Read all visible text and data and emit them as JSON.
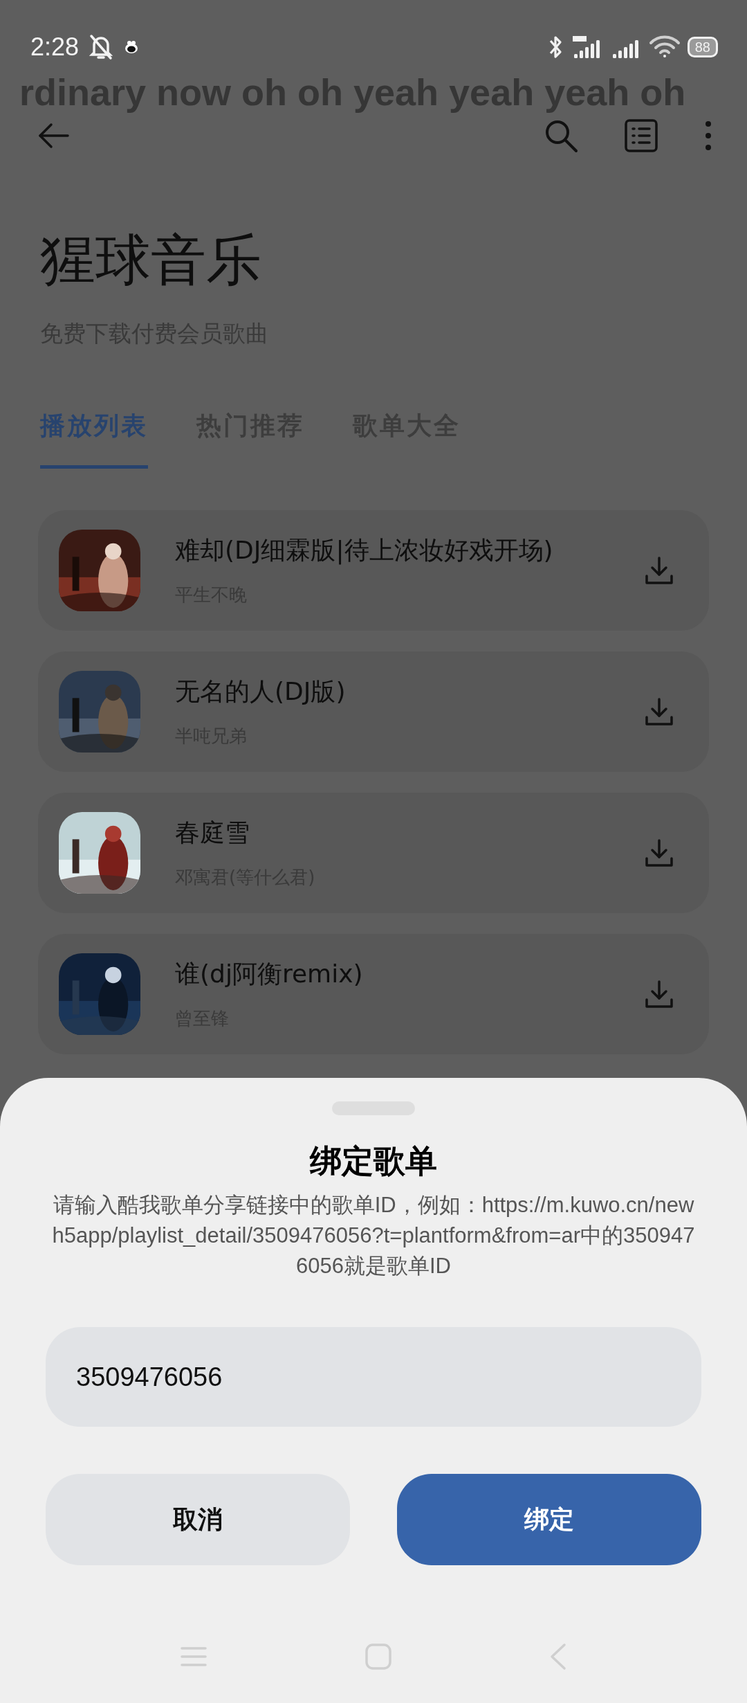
{
  "status_bar": {
    "time": "2:28",
    "battery": "88"
  },
  "lyrics_banner": {
    "text": "rdinary now oh oh yeah yeah yeah oh"
  },
  "header": {
    "title": "猩球音乐",
    "subtitle": "免费下载付费会员歌曲"
  },
  "tabs": [
    {
      "label": "播放列表",
      "selected": true
    },
    {
      "label": "热门推荐",
      "selected": false
    },
    {
      "label": "歌单大全",
      "selected": false
    }
  ],
  "songs": [
    {
      "title": "难却(DJ细霖版|待上浓妆好戏开场)",
      "artist": "平生不晚"
    },
    {
      "title": "无名的人(DJ版)",
      "artist": "半吨兄弟"
    },
    {
      "title": "春庭雪",
      "artist": "邓寓君(等什么君)"
    },
    {
      "title": "谁(dj阿衡remix)",
      "artist": "曾至锋"
    }
  ],
  "dialog": {
    "title": "绑定歌单",
    "message": "请输入酷我歌单分享链接中的歌单ID，例如：https://m.kuwo.cn/newh5app/playlist_detail/3509476056?t=plantform&from=ar中的3509476056就是歌单ID",
    "input": {
      "value": "3509476056"
    },
    "buttons": [
      {
        "label": "取消",
        "kind": "secondary"
      },
      {
        "label": "绑定",
        "kind": "primary"
      }
    ]
  }
}
